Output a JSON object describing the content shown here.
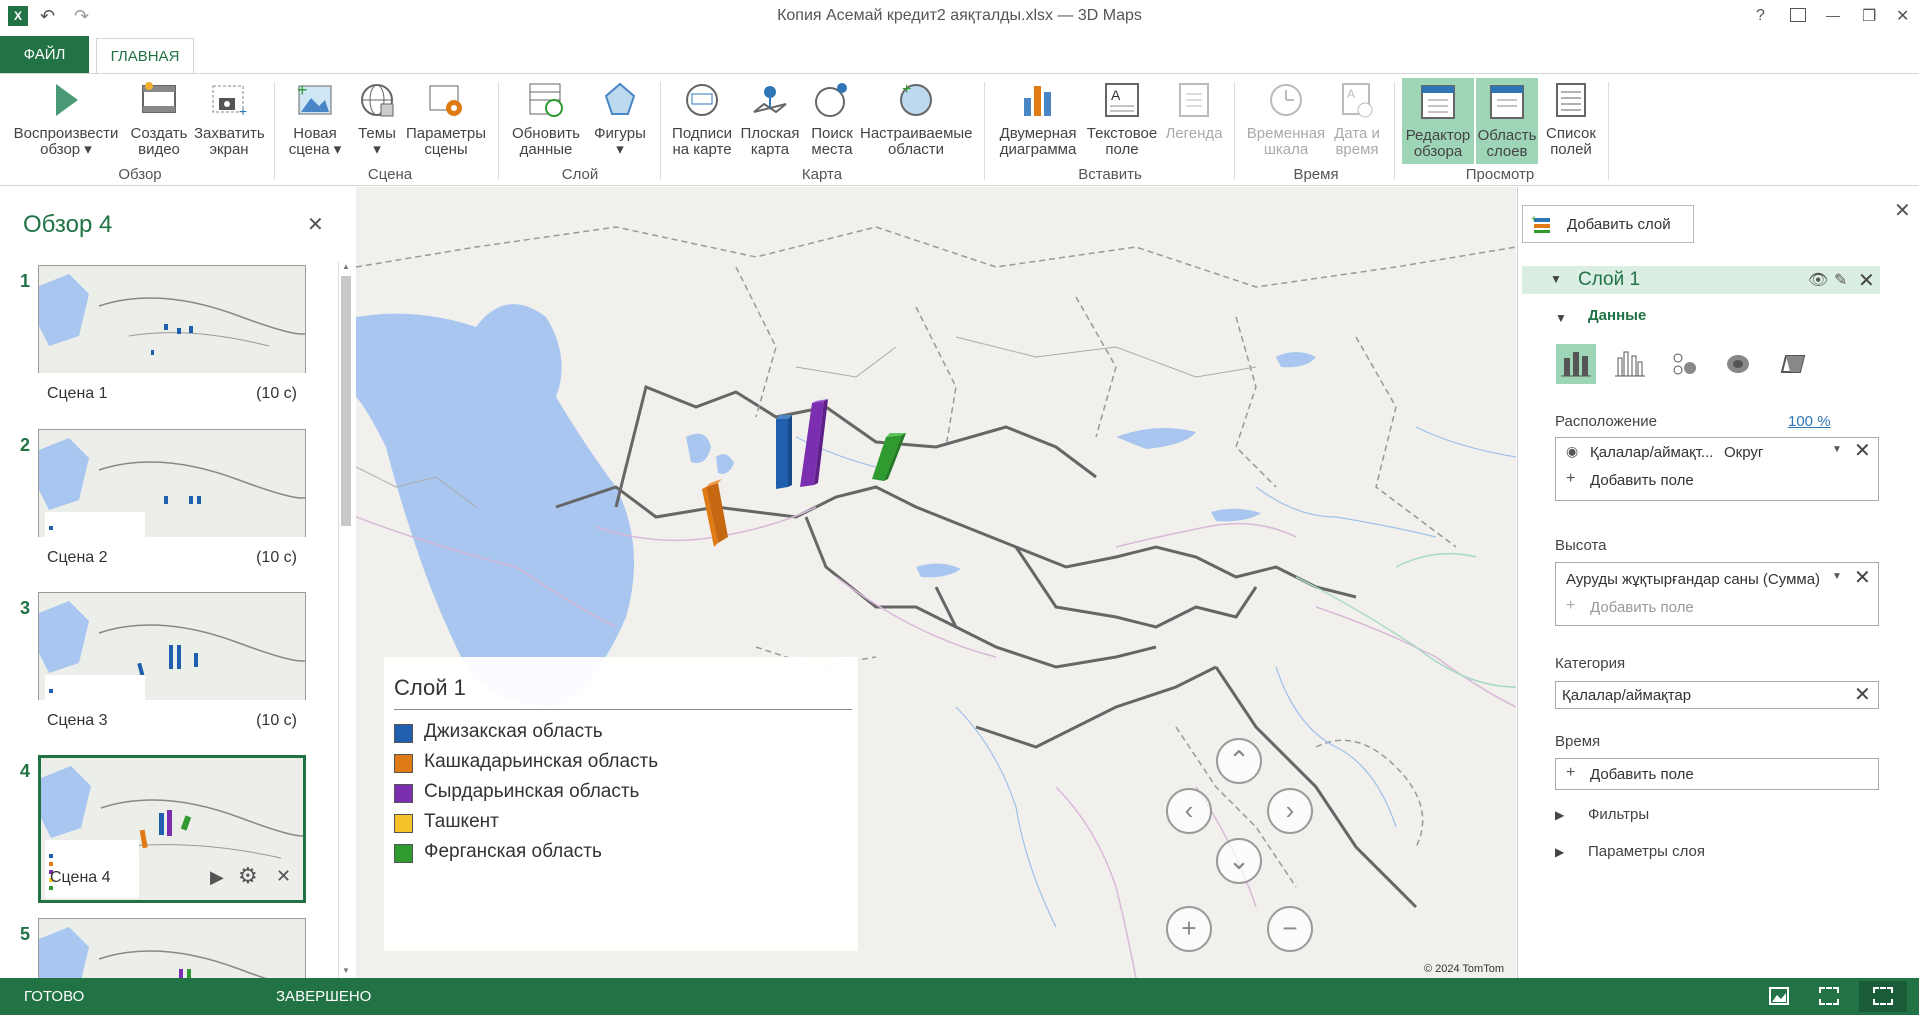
{
  "window": {
    "title": "Копия Асемай кредит2 аяқталды.xlsx — 3D Maps",
    "help": "?",
    "minimize": "—",
    "restore": "❐",
    "close": "✕"
  },
  "tabs": {
    "file": "ФАЙЛ",
    "home": "ГЛАВНАЯ"
  },
  "ribbon": {
    "play_tour": [
      "Воспроизвести",
      "обзор ▾"
    ],
    "create_video": [
      "Создать",
      "видео"
    ],
    "capture_screen": [
      "Захватить",
      "экран"
    ],
    "new_scene": [
      "Новая",
      "сцена ▾"
    ],
    "themes": [
      "Темы",
      "▾"
    ],
    "scene_options": [
      "Параметры",
      "сцены"
    ],
    "refresh_data": [
      "Обновить",
      "данные"
    ],
    "shapes": [
      "Фигуры",
      "▾"
    ],
    "map_labels": [
      "Подписи",
      "на карте"
    ],
    "flat_map": [
      "Плоская",
      "карта"
    ],
    "find_location": [
      "Поиск",
      "места"
    ],
    "custom_regions": [
      "Настраиваемые",
      "области"
    ],
    "chart_2d": [
      "Двумерная",
      "диаграмма"
    ],
    "text_box": [
      "Текстовое",
      "поле"
    ],
    "legend": [
      "Легенда",
      ""
    ],
    "timeline": [
      "Временная",
      "шкала"
    ],
    "date_time": [
      "Дата и",
      "время"
    ],
    "tour_editor": [
      "Редактор",
      "обзора"
    ],
    "layer_pane": [
      "Область",
      "слоев"
    ],
    "field_list": [
      "Список",
      "полей"
    ],
    "groups": {
      "tour": "Обзор",
      "scene": "Сцена",
      "layer": "Слой",
      "map": "Карта",
      "insert": "Вставить",
      "time": "Время",
      "view": "Просмотр"
    }
  },
  "tour": {
    "title": "Обзор 4",
    "close": "✕",
    "scenes": [
      {
        "num": "1",
        "name": "Сцена 1",
        "duration": "(10 с)"
      },
      {
        "num": "2",
        "name": "Сцена 2",
        "duration": "(10 с)"
      },
      {
        "num": "3",
        "name": "Сцена 3",
        "duration": "(10 с)"
      },
      {
        "num": "4",
        "name": "Сцена 4",
        "duration": ""
      },
      {
        "num": "5",
        "name": "",
        "duration": ""
      }
    ],
    "scene4_play": "▶",
    "scene4_settings": "⚙",
    "scene4_delete": "✕"
  },
  "map": {
    "legend": {
      "title": "Слой 1",
      "items": [
        {
          "label": "Джизакская область",
          "color": "#1f5fad"
        },
        {
          "label": "Кашкадарьинская область",
          "color": "#e07a14"
        },
        {
          "label": "Сырдарьинская область",
          "color": "#7b2fb0"
        },
        {
          "label": "Ташкент",
          "color": "#f5c22a"
        },
        {
          "label": "Ферганская область",
          "color": "#2f9a2f"
        }
      ]
    },
    "nav": {
      "up": "⌃",
      "down": "⌄",
      "left": "‹",
      "right": "›",
      "zoom_in": "+",
      "zoom_out": "−"
    },
    "copyright": "© 2024 TomTom"
  },
  "layer_pane": {
    "close": "✕",
    "add_layer": "Добавить слой",
    "layer_name": "Слой 1",
    "data_section": "Данные",
    "location_label": "Расположение",
    "location_percent": "100 %",
    "location_field": "Қалалар/аймақт...",
    "location_type": "Округ",
    "add_field": "Добавить поле",
    "height_label": "Высота",
    "height_field": "Ауруды жұқтырғандар саны (Сумма)",
    "category_label": "Категория",
    "category_field": "Қалалар/аймақтар",
    "time_label": "Время",
    "filters": "Фильтры",
    "layer_options": "Параметры слоя"
  },
  "status": {
    "ready": "ГОТОВО",
    "done": "ЗАВЕРШЕНО"
  }
}
